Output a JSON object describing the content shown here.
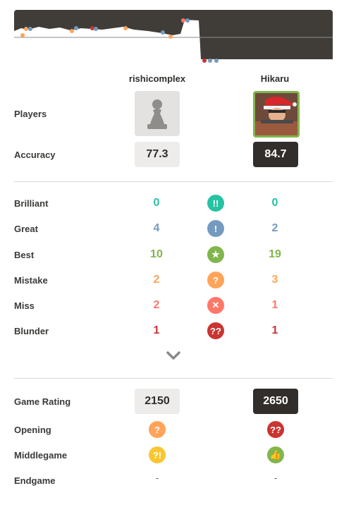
{
  "players": {
    "white": {
      "name": "rishicomplex",
      "accuracy": "77.3",
      "game_rating": "2150"
    },
    "black": {
      "name": "Hikaru",
      "accuracy": "84.7",
      "game_rating": "2650"
    }
  },
  "labels": {
    "players": "Players",
    "accuracy": "Accuracy",
    "game_rating": "Game Rating",
    "opening": "Opening",
    "middlegame": "Middlegame",
    "endgame": "Endgame"
  },
  "classifications": [
    {
      "label": "Brilliant",
      "white": "0",
      "black": "0",
      "icon": "brilliant-icon",
      "glyph": "!!",
      "color": "#26c2a3"
    },
    {
      "label": "Great",
      "white": "4",
      "black": "2",
      "icon": "great-icon",
      "glyph": "!",
      "color": "#749bbf"
    },
    {
      "label": "Best",
      "white": "10",
      "black": "19",
      "icon": "best-star-icon",
      "glyph": "★",
      "color": "#81b64c"
    },
    {
      "label": "Mistake",
      "white": "2",
      "black": "3",
      "icon": "mistake-icon",
      "glyph": "?",
      "color": "#ffa459"
    },
    {
      "label": "Miss",
      "white": "2",
      "black": "1",
      "icon": "miss-icon",
      "glyph": "✕",
      "color": "#ff7769"
    },
    {
      "label": "Blunder",
      "white": "1",
      "black": "1",
      "icon": "blunder-icon",
      "glyph": "??",
      "color": "#ca3431"
    }
  ],
  "phases": {
    "opening": {
      "white_icon": "mistake-icon",
      "white_glyph": "?",
      "white_color": "#ffa459",
      "black_icon": "blunder-icon",
      "black_glyph": "??",
      "black_color": "#ca3431"
    },
    "middlegame": {
      "white_icon": "inaccuracy-icon",
      "white_glyph": "?!",
      "white_color": "#f7c631",
      "black_icon": "thumbs-up-icon",
      "black_glyph": "👍",
      "black_color": "#81b64c"
    },
    "endgame": {
      "white": "-",
      "black": "-"
    }
  },
  "colors": {
    "accent_green": "#81b64c",
    "dark": "#312e2b"
  }
}
